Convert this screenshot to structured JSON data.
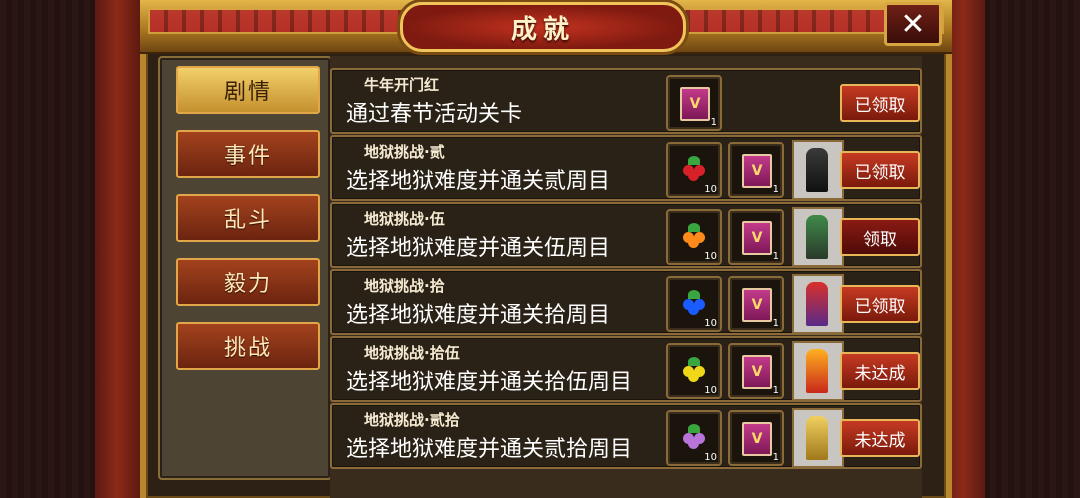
{
  "window": {
    "title": "成就",
    "close_label": "✕"
  },
  "tabs": [
    {
      "label": "剧情",
      "active": true
    },
    {
      "label": "事件",
      "active": false
    },
    {
      "label": "乱斗",
      "active": false
    },
    {
      "label": "毅力",
      "active": false
    },
    {
      "label": "挑战",
      "active": false
    }
  ],
  "achievements": [
    {
      "subtitle": "牛年开门红",
      "description": "通过春节活动关卡",
      "rewards": [
        {
          "icon": "book-v-icon",
          "letter": "V",
          "count": "1"
        }
      ],
      "status": "已领取"
    },
    {
      "subtitle": "地狱挑战·贰",
      "description": "选择地狱难度并通关贰周目",
      "rewards": [
        {
          "icon": "red-berry-icon",
          "count": "10",
          "color": "#d8202a"
        },
        {
          "icon": "book-v-icon",
          "letter": "V",
          "count": "1"
        }
      ],
      "portrait": "dark-winged-demon-icon",
      "status": "已领取"
    },
    {
      "subtitle": "地狱挑战·伍",
      "description": "选择地狱难度并通关伍周目",
      "rewards": [
        {
          "icon": "orange-berry-icon",
          "count": "10",
          "color": "#ff8a1a"
        },
        {
          "icon": "book-v-icon",
          "letter": "V",
          "count": "1"
        }
      ],
      "portrait": "green-ninja-icon",
      "status": "领取"
    },
    {
      "subtitle": "地狱挑战·拾",
      "description": "选择地狱难度并通关拾周目",
      "rewards": [
        {
          "icon": "blue-berry-icon",
          "count": "10",
          "color": "#1a5cff"
        },
        {
          "icon": "book-v-icon",
          "letter": "V",
          "count": "1"
        }
      ],
      "portrait": "red-hair-warrior-icon",
      "status": "已领取"
    },
    {
      "subtitle": "地狱挑战·拾伍",
      "description": "选择地狱难度并通关拾伍周目",
      "rewards": [
        {
          "icon": "yellow-berry-icon",
          "count": "10",
          "color": "#f0d818"
        },
        {
          "icon": "book-v-icon",
          "letter": "V",
          "count": "1"
        }
      ],
      "portrait": "flame-warrior-icon",
      "status": "未达成"
    },
    {
      "subtitle": "地狱挑战·贰拾",
      "description": "选择地狱难度并通关贰拾周目",
      "rewards": [
        {
          "icon": "purple-berry-icon",
          "count": "10",
          "color": "#b874d8"
        },
        {
          "icon": "book-v-icon",
          "letter": "V",
          "count": "1"
        }
      ],
      "portrait": "golden-armor-icon",
      "status": "未达成"
    }
  ],
  "colors": {
    "frame_gold": "#b8862c",
    "button_red": "#c63a22",
    "tab_active": "#f2cf6a"
  }
}
